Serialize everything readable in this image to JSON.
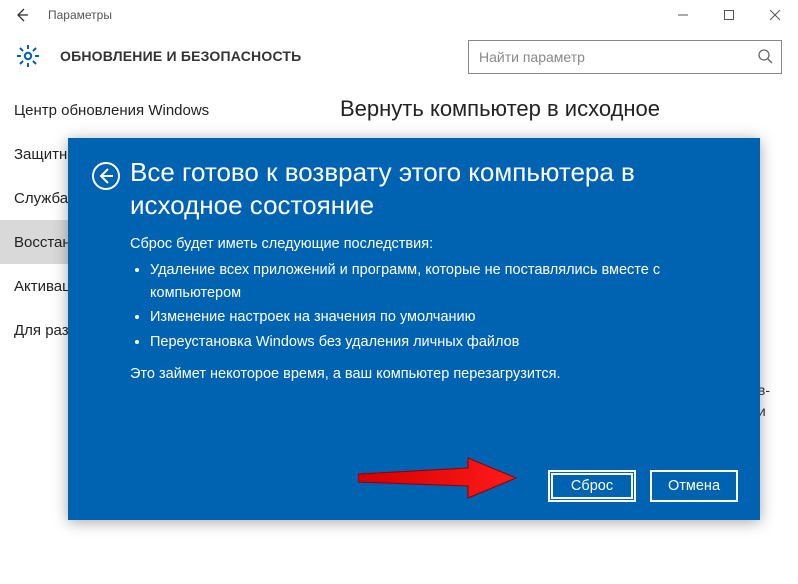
{
  "titlebar": {
    "title": "Параметры"
  },
  "header": {
    "section": "ОБНОВЛЕНИЕ И БЕЗОПАСНОСТЬ",
    "search_placeholder": "Найти параметр"
  },
  "sidebar": {
    "items": [
      {
        "label": "Центр обновления Windows"
      },
      {
        "label": "Защитник Windows"
      },
      {
        "label": "Служба архивации"
      },
      {
        "label": "Восстановление"
      },
      {
        "label": "Активация"
      },
      {
        "label": "Для разработчиков"
      }
    ],
    "selected_index": 3
  },
  "content": {
    "heading": "Вернуть компьютер в исходное",
    "truncated_tail_1": "в-",
    "truncated_tail_2": "и"
  },
  "dialog": {
    "title_line1": "Все готово к возврату этого компьютера в",
    "title_line2": "исходное состояние",
    "lead": "Сброс будет иметь следующие последствия:",
    "bullets": [
      "Удаление всех приложений и программ, которые не поставлялись вместе с компьютером",
      "Изменение настроек на значения по умолчанию",
      "Переустановка Windows без удаления личных файлов"
    ],
    "footer": "Это займет некоторое время, а ваш компьютер перезагрузится.",
    "primary": "Сброс",
    "secondary": "Отмена"
  }
}
